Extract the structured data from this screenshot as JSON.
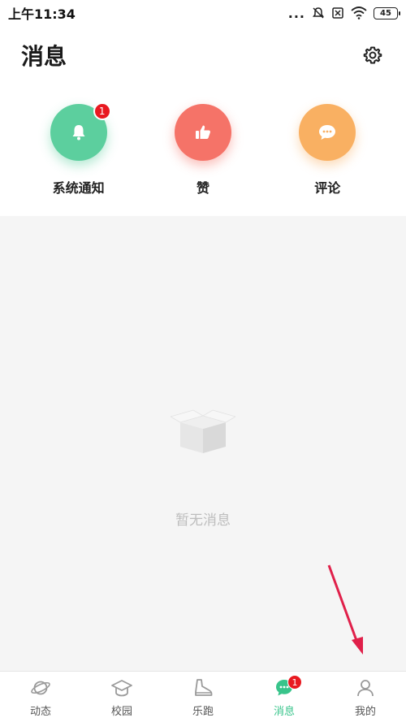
{
  "status_bar": {
    "time": "上午11:34",
    "dots": "...",
    "battery": "45"
  },
  "header": {
    "title": "消息"
  },
  "categories": [
    {
      "label": "系统通知",
      "badge": "1",
      "icon": "bell-icon",
      "color": "#5ccf9e"
    },
    {
      "label": "赞",
      "icon": "thumbs-up-icon",
      "color": "#f57368"
    },
    {
      "label": "评论",
      "icon": "comment-icon",
      "color": "#f9b062"
    }
  ],
  "empty_state": {
    "text": "暂无消息"
  },
  "tabbar": {
    "active_color": "#38c48b",
    "items": [
      {
        "label": "动态",
        "icon": "planet-icon"
      },
      {
        "label": "校园",
        "icon": "graduation-cap-icon"
      },
      {
        "label": "乐跑",
        "icon": "shoe-icon"
      },
      {
        "label": "消息",
        "icon": "chat-bubble-icon",
        "badge": "1",
        "active": true
      },
      {
        "label": "我的",
        "icon": "person-icon"
      }
    ]
  }
}
